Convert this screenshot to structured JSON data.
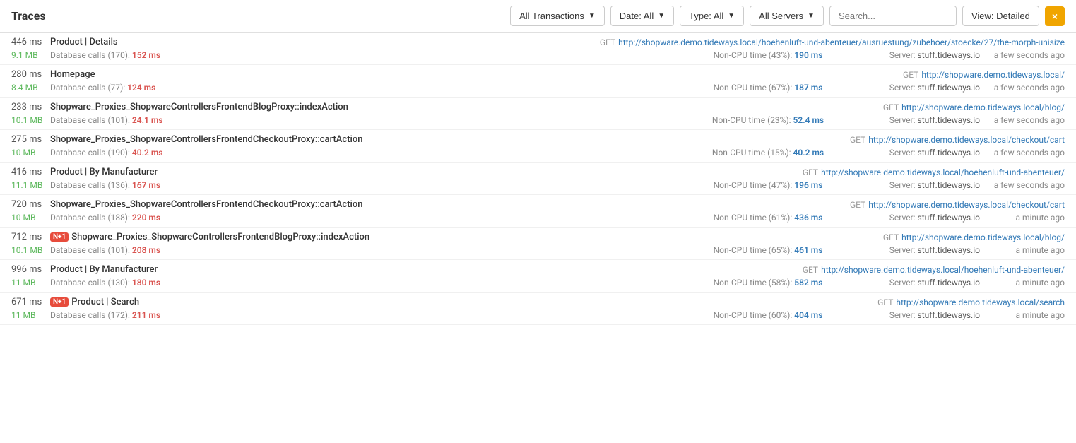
{
  "header": {
    "title": "Traces",
    "filters": {
      "transactions_label": "All Transactions",
      "date_label": "Date: All",
      "type_label": "Type: All",
      "servers_label": "All Servers",
      "search_placeholder": "Search...",
      "view_label": "View: Detailed",
      "close_icon": "×"
    }
  },
  "traces": [
    {
      "duration": "446 ms",
      "name": "Product | Details",
      "has_n1": false,
      "url_method": "GET",
      "url": "http://shopware.demo.tideways.local/hoehenluft-und-abenteuer/ausruestung/zubehoer/stoecke/27/the-morph-unisize",
      "memory": "9.1 MB",
      "db_calls": "Database calls (170):",
      "db_time": "152 ms",
      "noncpu_pct": "43%",
      "noncpu_time": "190 ms",
      "server": "stuff.tideways.io",
      "ago": "a few seconds ago"
    },
    {
      "duration": "280 ms",
      "name": "Homepage",
      "has_n1": false,
      "url_method": "GET",
      "url": "http://shopware.demo.tideways.local/",
      "memory": "8.4 MB",
      "db_calls": "Database calls (77):",
      "db_time": "124 ms",
      "noncpu_pct": "67%",
      "noncpu_time": "187 ms",
      "server": "stuff.tideways.io",
      "ago": "a few seconds ago"
    },
    {
      "duration": "233 ms",
      "name": "Shopware_Proxies_ShopwareControllersFrontendBlogProxy::indexAction",
      "has_n1": false,
      "url_method": "GET",
      "url": "http://shopware.demo.tideways.local/blog/",
      "memory": "10.1 MB",
      "db_calls": "Database calls (101):",
      "db_time": "24.1 ms",
      "noncpu_pct": "23%",
      "noncpu_time": "52.4 ms",
      "server": "stuff.tideways.io",
      "ago": "a few seconds ago"
    },
    {
      "duration": "275 ms",
      "name": "Shopware_Proxies_ShopwareControllersFrontendCheckoutProxy::cartAction",
      "has_n1": false,
      "url_method": "GET",
      "url": "http://shopware.demo.tideways.local/checkout/cart",
      "memory": "10 MB",
      "db_calls": "Database calls (190):",
      "db_time": "40.2 ms",
      "noncpu_pct": "15%",
      "noncpu_time": "40.2 ms",
      "server": "stuff.tideways.io",
      "ago": "a few seconds ago"
    },
    {
      "duration": "416 ms",
      "name": "Product | By Manufacturer",
      "has_n1": false,
      "url_method": "GET",
      "url": "http://shopware.demo.tideways.local/hoehenluft-und-abenteuer/",
      "memory": "11.1 MB",
      "db_calls": "Database calls (136):",
      "db_time": "167 ms",
      "noncpu_pct": "47%",
      "noncpu_time": "196 ms",
      "server": "stuff.tideways.io",
      "ago": "a few seconds ago"
    },
    {
      "duration": "720 ms",
      "name": "Shopware_Proxies_ShopwareControllersFrontendCheckoutProxy::cartAction",
      "has_n1": false,
      "url_method": "GET",
      "url": "http://shopware.demo.tideways.local/checkout/cart",
      "memory": "10 MB",
      "db_calls": "Database calls (188):",
      "db_time": "220 ms",
      "noncpu_pct": "61%",
      "noncpu_time": "436 ms",
      "server": "stuff.tideways.io",
      "ago": "a minute ago"
    },
    {
      "duration": "712 ms",
      "name": "Shopware_Proxies_ShopwareControllersFrontendBlogProxy::indexAction",
      "has_n1": true,
      "url_method": "GET",
      "url": "http://shopware.demo.tideways.local/blog/",
      "memory": "10.1 MB",
      "db_calls": "Database calls (101):",
      "db_time": "208 ms",
      "noncpu_pct": "65%",
      "noncpu_time": "461 ms",
      "server": "stuff.tideways.io",
      "ago": "a minute ago"
    },
    {
      "duration": "996 ms",
      "name": "Product | By Manufacturer",
      "has_n1": false,
      "url_method": "GET",
      "url": "http://shopware.demo.tideways.local/hoehenluft-und-abenteuer/",
      "memory": "11 MB",
      "db_calls": "Database calls (130):",
      "db_time": "180 ms",
      "noncpu_pct": "58%",
      "noncpu_time": "582 ms",
      "server": "stuff.tideways.io",
      "ago": "a minute ago"
    },
    {
      "duration": "671 ms",
      "name": "Product | Search",
      "has_n1": true,
      "url_method": "GET",
      "url": "http://shopware.demo.tideways.local/search",
      "memory": "11 MB",
      "db_calls": "Database calls (172):",
      "db_time": "211 ms",
      "noncpu_pct": "60%",
      "noncpu_time": "404 ms",
      "server": "stuff.tideways.io",
      "ago": "a minute ago"
    }
  ]
}
